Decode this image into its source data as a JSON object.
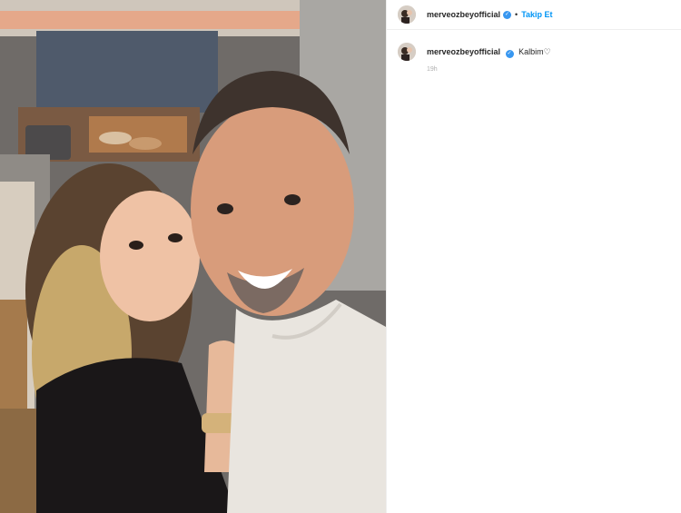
{
  "post": {
    "username": "merveozbeyofficial",
    "follow_label": "Takip Et",
    "separator": "•",
    "verified_glyph": "✓",
    "caption": {
      "username": "merveozbeyofficial",
      "text": "Kalbim",
      "heart_glyph": "♡",
      "time_ago": "19h"
    }
  },
  "colors": {
    "follow": "#0095f6",
    "verified_badge": "#3897f0",
    "timestamp": "#b0b0b0"
  },
  "icons": [
    "verified-badge-icon",
    "heart-icon"
  ]
}
